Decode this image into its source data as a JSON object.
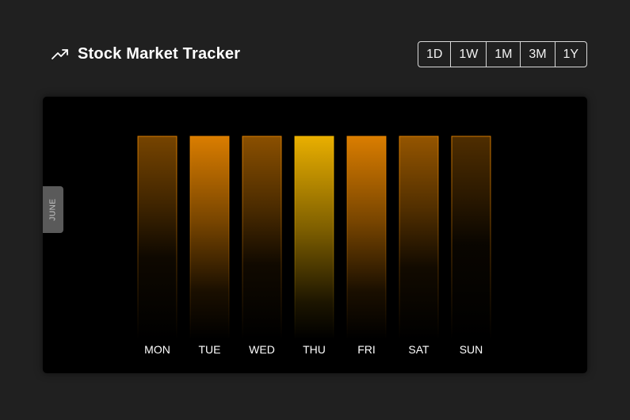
{
  "header": {
    "title": "Stock Market Tracker",
    "icon": "trending-up-icon"
  },
  "range_buttons": [
    "1D",
    "1W",
    "1M",
    "3M",
    "1Y"
  ],
  "month_tab": {
    "label": "JUNE"
  },
  "colors": {
    "background": "#202020",
    "panel": "#000000",
    "accent_orange": "#f08a00",
    "accent_yellow": "#f5b800"
  },
  "chart_data": {
    "type": "bar",
    "categories": [
      "MON",
      "TUE",
      "WED",
      "THU",
      "FRI",
      "SAT",
      "SUN"
    ],
    "values": [
      1,
      1,
      1,
      1,
      1,
      1,
      1
    ],
    "intensity": [
      0.45,
      0.95,
      0.55,
      1.0,
      0.95,
      0.6,
      0.25
    ],
    "title": "",
    "xlabel": "",
    "ylabel": "",
    "grid": false
  }
}
